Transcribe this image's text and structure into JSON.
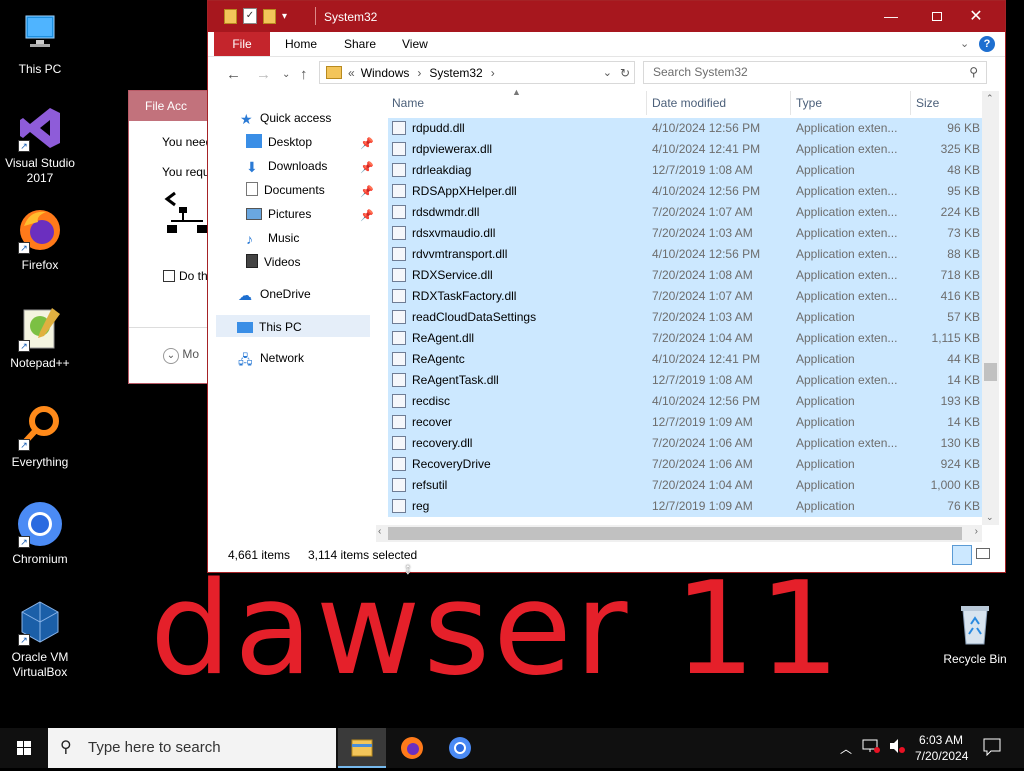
{
  "desktop": {
    "icons": [
      {
        "label": "This PC"
      },
      {
        "label": "Visual Studio 2017"
      },
      {
        "label": "Firefox"
      },
      {
        "label": "Notepad++"
      },
      {
        "label": "Everything"
      },
      {
        "label": "Chromium"
      },
      {
        "label": "Oracle VM VirtualBox"
      },
      {
        "label": "Recycle Bin"
      }
    ],
    "wallpaper_text": "dawser 11"
  },
  "bg_dialog": {
    "title": "File Acc",
    "line1": "You need",
    "line2": "You requ",
    "checkbox": "Do th",
    "more": "Mo"
  },
  "explorer": {
    "title": "System32",
    "ribbon": {
      "file": "File",
      "home": "Home",
      "share": "Share",
      "view": "View"
    },
    "address": {
      "prefix": "«",
      "crumb1": "Windows",
      "crumb2": "System32"
    },
    "search_placeholder": "Search System32",
    "nav": {
      "quick_access": "Quick access",
      "desktop": "Desktop",
      "downloads": "Downloads",
      "documents": "Documents",
      "pictures": "Pictures",
      "music": "Music",
      "videos": "Videos",
      "onedrive": "OneDrive",
      "this_pc": "This PC",
      "network": "Network"
    },
    "columns": {
      "name": "Name",
      "date": "Date modified",
      "type": "Type",
      "size": "Size"
    },
    "files": [
      {
        "name": "rdpudd.dll",
        "date": "4/10/2024 12:56 PM",
        "type": "Application exten...",
        "size": "96 KB"
      },
      {
        "name": "rdpviewerax.dll",
        "date": "4/10/2024 12:41 PM",
        "type": "Application exten...",
        "size": "325 KB"
      },
      {
        "name": "rdrleakdiag",
        "date": "12/7/2019 1:08 AM",
        "type": "Application",
        "size": "48 KB"
      },
      {
        "name": "RDSAppXHelper.dll",
        "date": "4/10/2024 12:56 PM",
        "type": "Application exten...",
        "size": "95 KB"
      },
      {
        "name": "rdsdwmdr.dll",
        "date": "7/20/2024 1:07 AM",
        "type": "Application exten...",
        "size": "224 KB"
      },
      {
        "name": "rdsxvmaudio.dll",
        "date": "7/20/2024 1:03 AM",
        "type": "Application exten...",
        "size": "73 KB"
      },
      {
        "name": "rdvvmtransport.dll",
        "date": "4/10/2024 12:56 PM",
        "type": "Application exten...",
        "size": "88 KB"
      },
      {
        "name": "RDXService.dll",
        "date": "7/20/2024 1:08 AM",
        "type": "Application exten...",
        "size": "718 KB"
      },
      {
        "name": "RDXTaskFactory.dll",
        "date": "7/20/2024 1:07 AM",
        "type": "Application exten...",
        "size": "416 KB"
      },
      {
        "name": "readCloudDataSettings",
        "date": "7/20/2024 1:03 AM",
        "type": "Application",
        "size": "57 KB"
      },
      {
        "name": "ReAgent.dll",
        "date": "7/20/2024 1:04 AM",
        "type": "Application exten...",
        "size": "1,115 KB"
      },
      {
        "name": "ReAgentc",
        "date": "4/10/2024 12:41 PM",
        "type": "Application",
        "size": "44 KB"
      },
      {
        "name": "ReAgentTask.dll",
        "date": "12/7/2019 1:08 AM",
        "type": "Application exten...",
        "size": "14 KB"
      },
      {
        "name": "recdisc",
        "date": "4/10/2024 12:56 PM",
        "type": "Application",
        "size": "193 KB"
      },
      {
        "name": "recover",
        "date": "12/7/2019 1:09 AM",
        "type": "Application",
        "size": "14 KB"
      },
      {
        "name": "recovery.dll",
        "date": "7/20/2024 1:06 AM",
        "type": "Application exten...",
        "size": "130 KB"
      },
      {
        "name": "RecoveryDrive",
        "date": "7/20/2024 1:06 AM",
        "type": "Application",
        "size": "924 KB"
      },
      {
        "name": "refsutil",
        "date": "7/20/2024 1:04 AM",
        "type": "Application",
        "size": "1,000 KB"
      },
      {
        "name": "reg",
        "date": "12/7/2019 1:09 AM",
        "type": "Application",
        "size": "76 KB"
      }
    ],
    "status": {
      "items": "4,661 items",
      "selected": "3,114 items selected"
    }
  },
  "taskbar": {
    "search_placeholder": "Type here to search",
    "time": "6:03 AM",
    "date": "7/20/2024"
  }
}
